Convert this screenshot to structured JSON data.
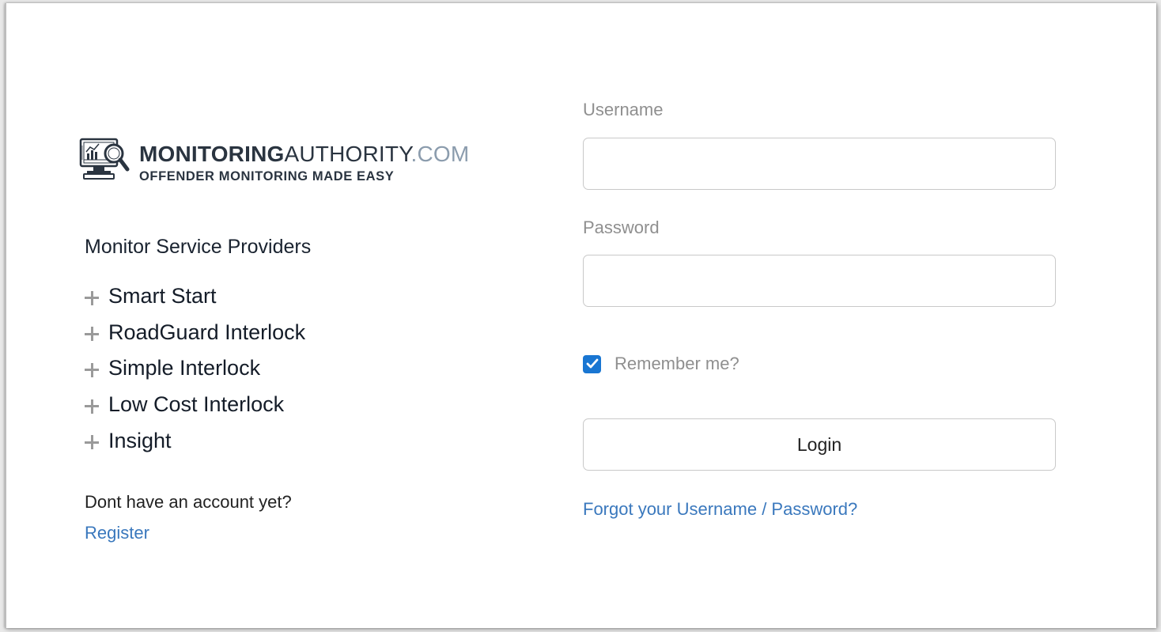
{
  "brand": {
    "name_bold": "MONITORING",
    "name_regular": "AUTHORITY",
    "name_suffix": ".COM",
    "tagline": "OFFENDER MONITORING MADE EASY"
  },
  "providers": {
    "title": "Monitor Service Providers",
    "items": [
      {
        "label": "Smart Start"
      },
      {
        "label": "RoadGuard Interlock"
      },
      {
        "label": "Simple Interlock"
      },
      {
        "label": "Low Cost Interlock"
      },
      {
        "label": "Insight"
      }
    ]
  },
  "account": {
    "prompt": "Dont have an account yet?",
    "register_label": "Register"
  },
  "form": {
    "username_label": "Username",
    "username_value": "",
    "password_label": "Password",
    "password_value": "",
    "remember_label": "Remember me?",
    "remember_checked": true,
    "login_label": "Login",
    "forgot_label": "Forgot your Username / Password?"
  },
  "colors": {
    "link": "#3a78bd",
    "checkbox": "#1976d2",
    "brand_dark": "#2a3440",
    "brand_light": "#8b9cad"
  }
}
